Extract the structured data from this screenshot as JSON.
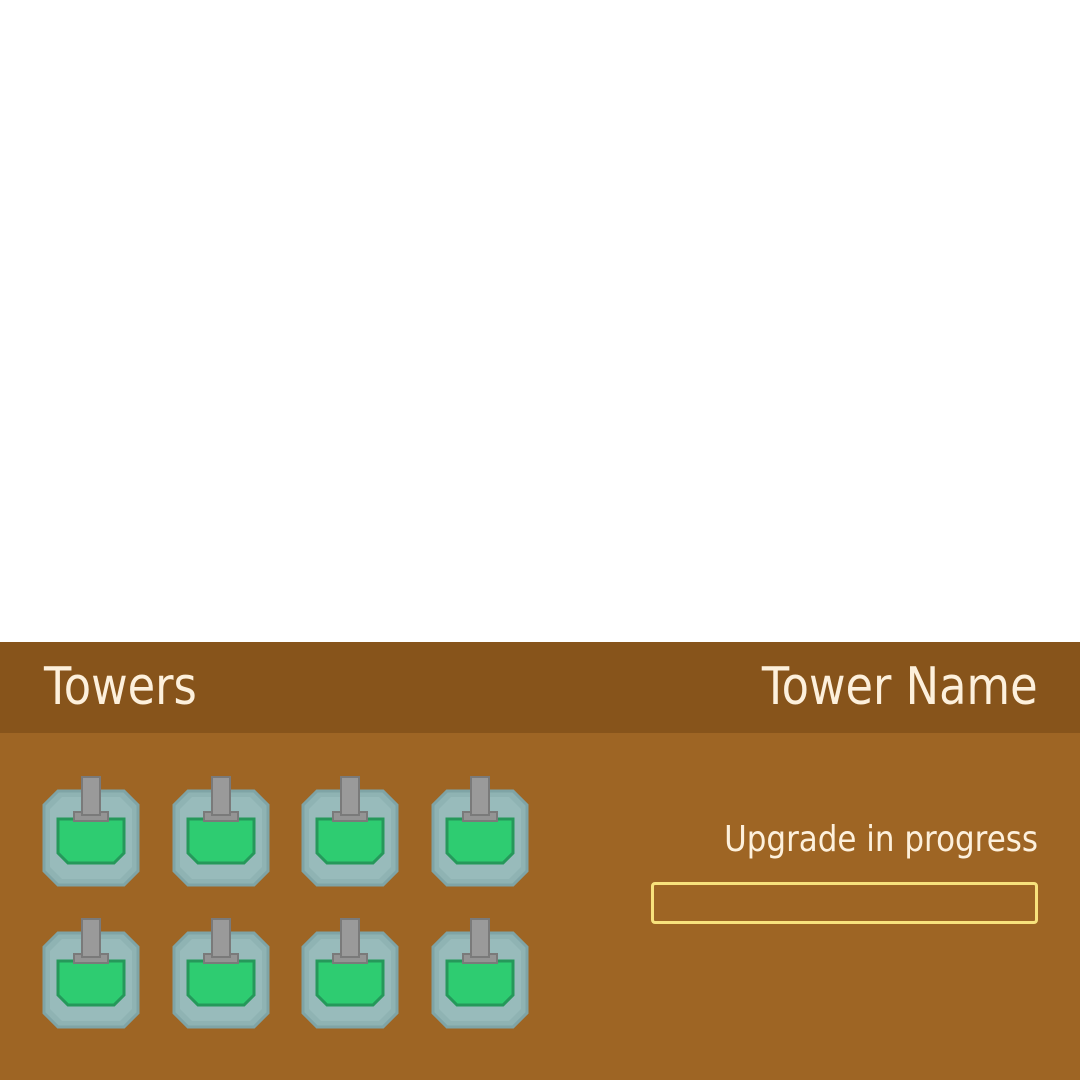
{
  "panel": {
    "towers_title": "Towers",
    "tower_name": "Tower Name",
    "status_text": "Upgrade in progress",
    "upgrade_progress": 0,
    "colors": {
      "header_bg": "#87541b",
      "panel_bg": "#9e6524",
      "text": "#fdf0dc",
      "progress_border": "#f8e27c"
    }
  },
  "towers": [
    {
      "icon": "turret-tower-icon",
      "turret_color": "#2ecc71"
    },
    {
      "icon": "turret-tower-icon",
      "turret_color": "#2ecc71"
    },
    {
      "icon": "turret-tower-icon",
      "turret_color": "#2ecc71"
    },
    {
      "icon": "turret-tower-icon",
      "turret_color": "#2ecc71"
    },
    {
      "icon": "turret-tower-icon",
      "turret_color": "#2ecc71"
    },
    {
      "icon": "turret-tower-icon",
      "turret_color": "#2ecc71"
    },
    {
      "icon": "turret-tower-icon",
      "turret_color": "#2ecc71"
    },
    {
      "icon": "turret-tower-icon",
      "turret_color": "#2ecc71"
    }
  ]
}
